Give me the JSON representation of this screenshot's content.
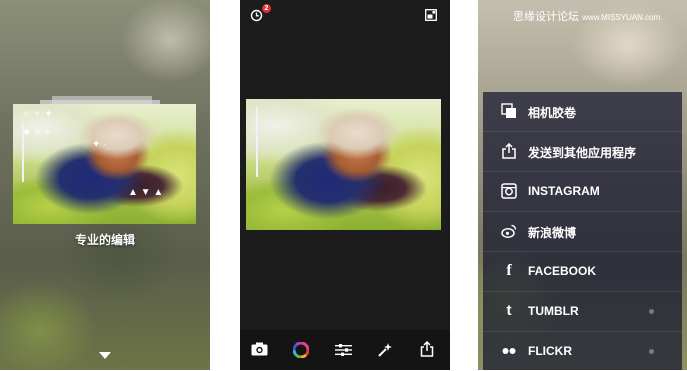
{
  "panel1": {
    "caption": "专业的编辑",
    "down_arrow_icon": "triangle-down-icon"
  },
  "panel2": {
    "history_badge_count": "2",
    "top_left_icon": "history-icon",
    "top_right_icon": "compare-icon",
    "toolbar": [
      {
        "name": "camera",
        "icon": "camera-icon"
      },
      {
        "name": "color-filter",
        "icon": "color-wheel-icon"
      },
      {
        "name": "adjust",
        "icon": "sliders-icon"
      },
      {
        "name": "auto-enhance",
        "icon": "magic-wand-icon"
      },
      {
        "name": "share",
        "icon": "share-icon"
      }
    ]
  },
  "panel3": {
    "watermark_text": "思缘设计论坛",
    "watermark_url": "www.MISSYUAN.com",
    "share_options": [
      {
        "label": "相机胶卷",
        "icon": "camera-roll-icon"
      },
      {
        "label": "发送到其他应用程序",
        "icon": "open-in-icon"
      },
      {
        "label": "INSTAGRAM",
        "icon": "instagram-icon"
      },
      {
        "label": "新浪微博",
        "icon": "weibo-icon"
      },
      {
        "label": "FACEBOOK",
        "icon": "facebook-icon"
      },
      {
        "label": "TUMBLR",
        "icon": "tumblr-icon"
      },
      {
        "label": "FLICKR",
        "icon": "flickr-icon"
      }
    ]
  },
  "colors": {
    "badge": "#e0303a",
    "editor_background": "#1c1c1c",
    "share_sheet": "#14162e"
  }
}
